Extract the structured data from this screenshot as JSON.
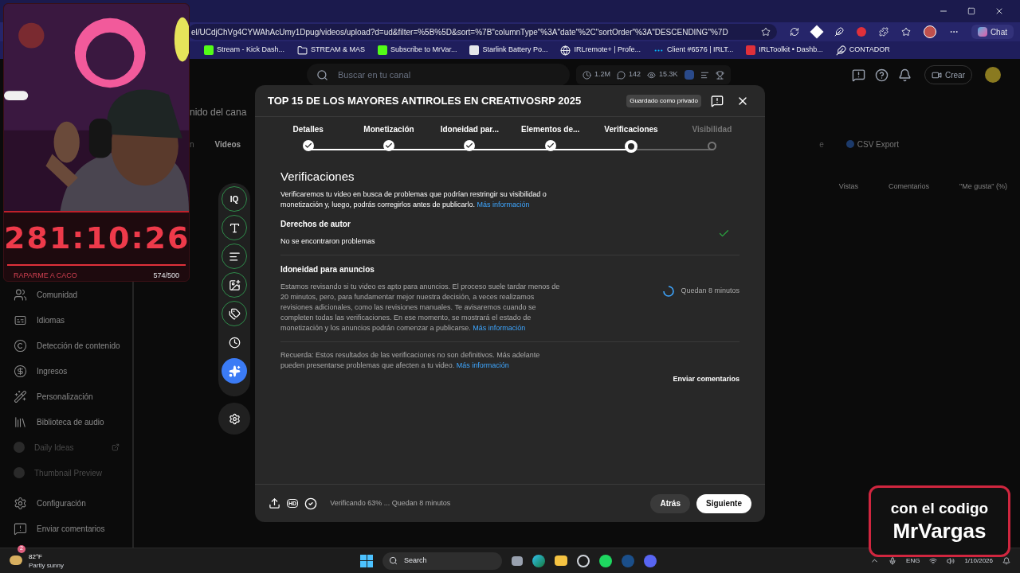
{
  "browser": {
    "url": "el/UCdjChVg4CYWAhAcUmy1Dpug/videos/upload?d=ud&filter=%5B%5D&sort=%7B\"columnType\"%3A\"date\"%2C\"sortOrder\"%3A\"DESCENDING\"%7D",
    "chat_label": "Chat",
    "bookmarks": [
      {
        "label": "Stream - Kick Dash...",
        "kind": "kick"
      },
      {
        "label": "STREAM & MAS",
        "kind": "folder"
      },
      {
        "label": "Subscribe to MrVar...",
        "kind": "kick"
      },
      {
        "label": "Starlink Battery Po...",
        "kind": "page"
      },
      {
        "label": "IRLremote+ | Profe...",
        "kind": "globe"
      },
      {
        "label": "Client #6576 | IRLT...",
        "kind": "dots"
      },
      {
        "label": "IRLToolkit • Dashb...",
        "kind": "red"
      },
      {
        "label": "CONTADOR",
        "kind": "ship"
      }
    ]
  },
  "yt_header": {
    "search_placeholder": "Buscar en tu canal",
    "stats": [
      {
        "value": "1.2M",
        "kind": "clock"
      },
      {
        "value": "142",
        "kind": "comment"
      },
      {
        "value": "15.3K",
        "kind": "eye"
      }
    ],
    "create_label": "Crear"
  },
  "background_page": {
    "title": "nido del cana",
    "tabs": [
      {
        "label": "n",
        "selected": false
      },
      {
        "label": "Videos",
        "selected": true
      },
      {
        "label": "e",
        "selected": false
      }
    ],
    "csv_label": "CSV Export",
    "columns": [
      "Vistas",
      "Comentarios",
      "\"Me gusta\" (%)"
    ]
  },
  "sidebar": {
    "items": [
      {
        "label": "Comunidad",
        "kind": "community",
        "disabled": false
      },
      {
        "label": "Idiomas",
        "kind": "subtitles",
        "disabled": false
      },
      {
        "label": "Detección de contenido",
        "kind": "copyright",
        "disabled": false
      },
      {
        "label": "Ingresos",
        "kind": "dollar",
        "disabled": false
      },
      {
        "label": "Personalización",
        "kind": "wand",
        "disabled": false
      },
      {
        "label": "Biblioteca de audio",
        "kind": "library",
        "disabled": false
      },
      {
        "label": "Daily Ideas",
        "kind": "ext",
        "disabled": true,
        "external": true
      },
      {
        "label": "Thumbnail Preview",
        "kind": "ext",
        "disabled": true,
        "external": false
      }
    ],
    "bottom_items": [
      {
        "label": "Configuración",
        "kind": "settings"
      },
      {
        "label": "Enviar comentarios",
        "kind": "feedback"
      }
    ]
  },
  "stream_overlay": {
    "timer": "281:10:26",
    "goal_label": "RAPARME A CACO",
    "goal_count": "574/500"
  },
  "tool_rail": [
    {
      "kind": "iq",
      "label": "IQ",
      "done": true
    },
    {
      "kind": "text",
      "done": true
    },
    {
      "kind": "description",
      "done": true
    },
    {
      "kind": "thumbnail",
      "done": true
    },
    {
      "kind": "tags",
      "done": true
    },
    {
      "kind": "clock",
      "done": false
    },
    {
      "kind": "ai",
      "done": false
    }
  ],
  "dialog": {
    "title": "TOP 15 DE LOS MAYORES ANTIROLES EN CREATIVOSRP 2025",
    "saved_badge": "Guardado como privado",
    "steps": [
      {
        "label": "Detalles",
        "done": true,
        "selected": false
      },
      {
        "label": "Monetización",
        "done": true,
        "selected": false
      },
      {
        "label": "Idoneidad par...",
        "done": true,
        "selected": false
      },
      {
        "label": "Elementos de...",
        "done": true,
        "selected": false
      },
      {
        "label": "Verificaciones",
        "done": false,
        "selected": true
      },
      {
        "label": "Visibilidad",
        "done": false,
        "selected": false
      }
    ],
    "heading": "Verificaciones",
    "intro": "Verificaremos tu video en busca de problemas que podrían restringir su visibilidad o monetización y, luego, podrás corregirlos antes de publicarlo.",
    "intro_link": "Más información",
    "sections": [
      {
        "title": "Derechos de autor",
        "text": "No se encontraron problemas",
        "complete": true
      },
      {
        "title": "Idoneidad para anuncios",
        "text": "Estamos revisando si tu video es apto para anuncios. El proceso suele tardar menos de 20 minutos, pero, para fundamentar mejor nuestra decisión, a veces realizamos revisiones adicionales, como las revisiones manuales. Te avisaremos cuando se completen todas las verificaciones. En ese momento, se mostrará el estado de monetización y los anuncios podrán comenzar a publicarse.",
        "link": "Más información",
        "complete": false,
        "status_text": "Quedan 8 minutos"
      }
    ],
    "note": "Recuerda: Estos resultados de las verificaciones no son definitivos. Más adelante pueden presentarse problemas que afecten a tu video.",
    "note_link": "Más información",
    "feedback": "Enviar comentarios",
    "footer": {
      "hd_label": "HD",
      "status": "Verificando 63% ... Quedan 8 minutos",
      "back": "Atrás",
      "next": "Siguiente"
    }
  },
  "promo": {
    "line1": "con el codigo",
    "line2": "MrVargas"
  },
  "taskbar": {
    "temp": "82°F",
    "weather": "Partly sunny",
    "weather_badge": "2",
    "search_label": "Search",
    "lang": "ENG",
    "date": "1/10/2026"
  }
}
